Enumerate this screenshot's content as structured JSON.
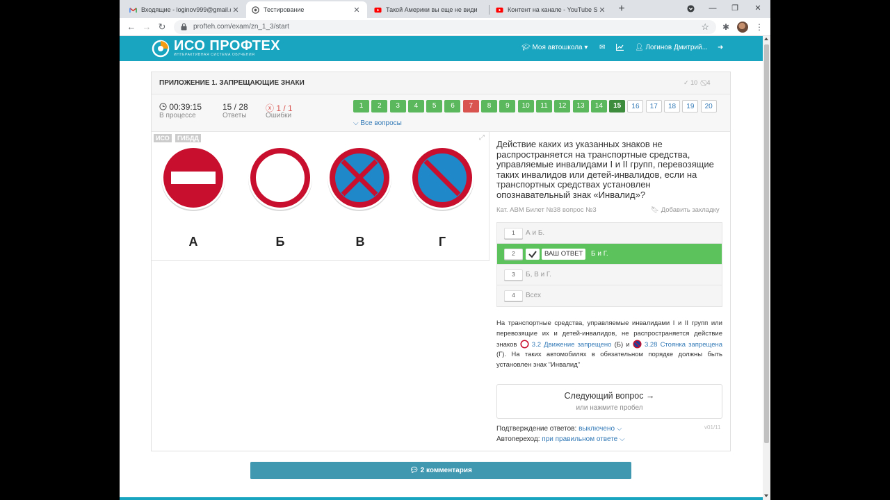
{
  "browser": {
    "tabs": [
      {
        "label": "Входящие - loginov999@gmail.c",
        "icon": "gmail-icon"
      },
      {
        "label": "Тестирование",
        "icon": "profteh-icon"
      },
      {
        "label": "Такой Америки вы еще не види",
        "icon": "youtube-icon"
      },
      {
        "label": "Контент на канале - YouTube St",
        "icon": "youtube-icon"
      }
    ],
    "url": "profteh.com/exam/zn_1_3/start"
  },
  "site": {
    "logo_title": "ИСО ПРОФТЕХ",
    "logo_subtitle": "ИНТЕРАКТИВНАЯ СИСТЕМА ОБУЧЕНИЯ",
    "nav_school": "Моя автошкола",
    "user_name": "Логинов Дмитрий..."
  },
  "exam": {
    "title": "ПРИЛОЖЕНИЕ 1. ЗАПРЕЩАЮЩИЕ ЗНАКИ",
    "header_correct": "10",
    "header_wrong": "4",
    "time": "00:39:15",
    "time_label": "В процессе",
    "answers": "15 / 28",
    "answers_label": "Ответы",
    "errors": "1 / 1",
    "errors_label": "Ошибки",
    "questions": [
      {
        "n": "1",
        "state": "ok"
      },
      {
        "n": "2",
        "state": "ok"
      },
      {
        "n": "3",
        "state": "ok"
      },
      {
        "n": "4",
        "state": "ok"
      },
      {
        "n": "5",
        "state": "ok"
      },
      {
        "n": "6",
        "state": "ok"
      },
      {
        "n": "7",
        "state": "err"
      },
      {
        "n": "8",
        "state": "ok"
      },
      {
        "n": "9",
        "state": "ok"
      },
      {
        "n": "10",
        "state": "ok"
      },
      {
        "n": "11",
        "state": "ok"
      },
      {
        "n": "12",
        "state": "ok"
      },
      {
        "n": "13",
        "state": "ok"
      },
      {
        "n": "14",
        "state": "ok"
      },
      {
        "n": "15",
        "state": "cur"
      },
      {
        "n": "16",
        "state": "todo"
      },
      {
        "n": "17",
        "state": "todo"
      },
      {
        "n": "18",
        "state": "todo"
      },
      {
        "n": "19",
        "state": "todo"
      },
      {
        "n": "20",
        "state": "todo"
      }
    ],
    "all_questions": "Все вопросы",
    "image_badges": [
      "ИСО",
      "ГИБДД"
    ],
    "sign_labels": [
      "А",
      "Б",
      "В",
      "Г"
    ],
    "colors": {
      "sign_red": "#c8102e",
      "sign_blue": "#1e88c9",
      "correct": "#5cc35c",
      "error": "#d9534f",
      "header": "#19a5bf"
    }
  },
  "question": {
    "text": "Действие каких из указанных знаков не распространяется на транспортные средства, управляемые инвалидами I и II групп, перевозящие таких инвалидов или детей-инвалидов, если на транспортных средствах установлен опознавательный знак «Инвалид»?",
    "meta": "Кат. ABM   Билет №38   вопрос №3",
    "bookmark": "Добавить закладку",
    "options": [
      {
        "num": "1",
        "text": "А и Б."
      },
      {
        "num": "2",
        "text": "Б и Г.",
        "yours": "ВАШ ОТВЕТ"
      },
      {
        "num": "3",
        "text": "Б, В и Г."
      },
      {
        "num": "4",
        "text": "Всех"
      }
    ],
    "explanation": {
      "p1": "На транспортные средства, управляемые инвалидами I и II групп или перевозящие их и детей-инвалидов, не распространяется действие знаков",
      "link1": "3.2 Движение запрещено",
      "p2": "(Б) и",
      "link2": "3.28 Стоянка запрещена",
      "p3": "(Г). На таких автомобилях в обязательном порядке должны быть установлен знак \"Инвалид\""
    },
    "next_label": "Следующий вопрос →",
    "next_hint": "или нажмите пробел",
    "version": "v01/11",
    "confirm_label": "Подтверждение ответов:",
    "confirm_value": "выключено",
    "auto_label": "Автопереход:",
    "auto_value": "при правильном ответе"
  },
  "comments_label": "2 комментария"
}
